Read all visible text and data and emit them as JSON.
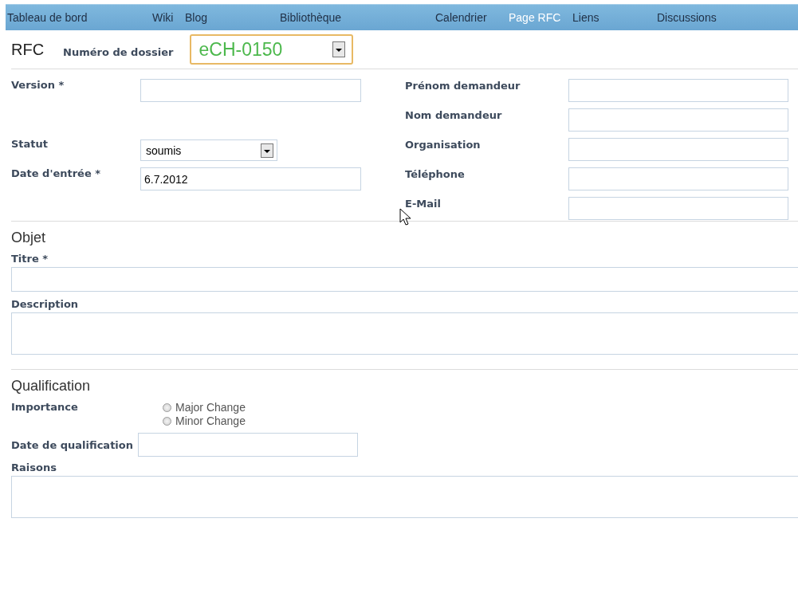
{
  "nav": [
    {
      "label": "Tableau de bord",
      "selected": false
    },
    {
      "label": "Wiki",
      "selected": false
    },
    {
      "label": "Blog",
      "selected": false
    },
    {
      "label": "Bibliothèque",
      "selected": false
    },
    {
      "label": "Calendrier",
      "selected": false
    },
    {
      "label": "Page RFC",
      "selected": true
    },
    {
      "label": "Liens",
      "selected": false
    },
    {
      "label": "Discussions",
      "selected": false
    }
  ],
  "header": {
    "title": "RFC",
    "dossier_label": "Numéro de dossier",
    "dossier_value": "eCH-0150"
  },
  "left_fields": [
    {
      "label": "Version *",
      "kind": "text"
    },
    {
      "kind": "blank"
    },
    {
      "label": "Statut",
      "kind": "select",
      "value": "soumis"
    },
    {
      "label": "Date d'entrée *",
      "kind": "text",
      "value": "6.7.2012"
    }
  ],
  "right_fields": [
    {
      "label": "Prénom demandeur"
    },
    {
      "label": "Nom demandeur"
    },
    {
      "label": "Organisation"
    },
    {
      "label": "Téléphone"
    },
    {
      "label": "E-Mail"
    }
  ],
  "objet": {
    "heading": "Objet",
    "title_label": "Titre *",
    "description_label": "Description"
  },
  "qualification": {
    "heading": "Qualification",
    "importance_label": "Importance",
    "options": [
      {
        "label": "Major Change",
        "selected": false
      },
      {
        "label": "Minor Change",
        "selected": false
      }
    ],
    "date_label": "Date de qualification",
    "reasons_label": "Raisons"
  }
}
